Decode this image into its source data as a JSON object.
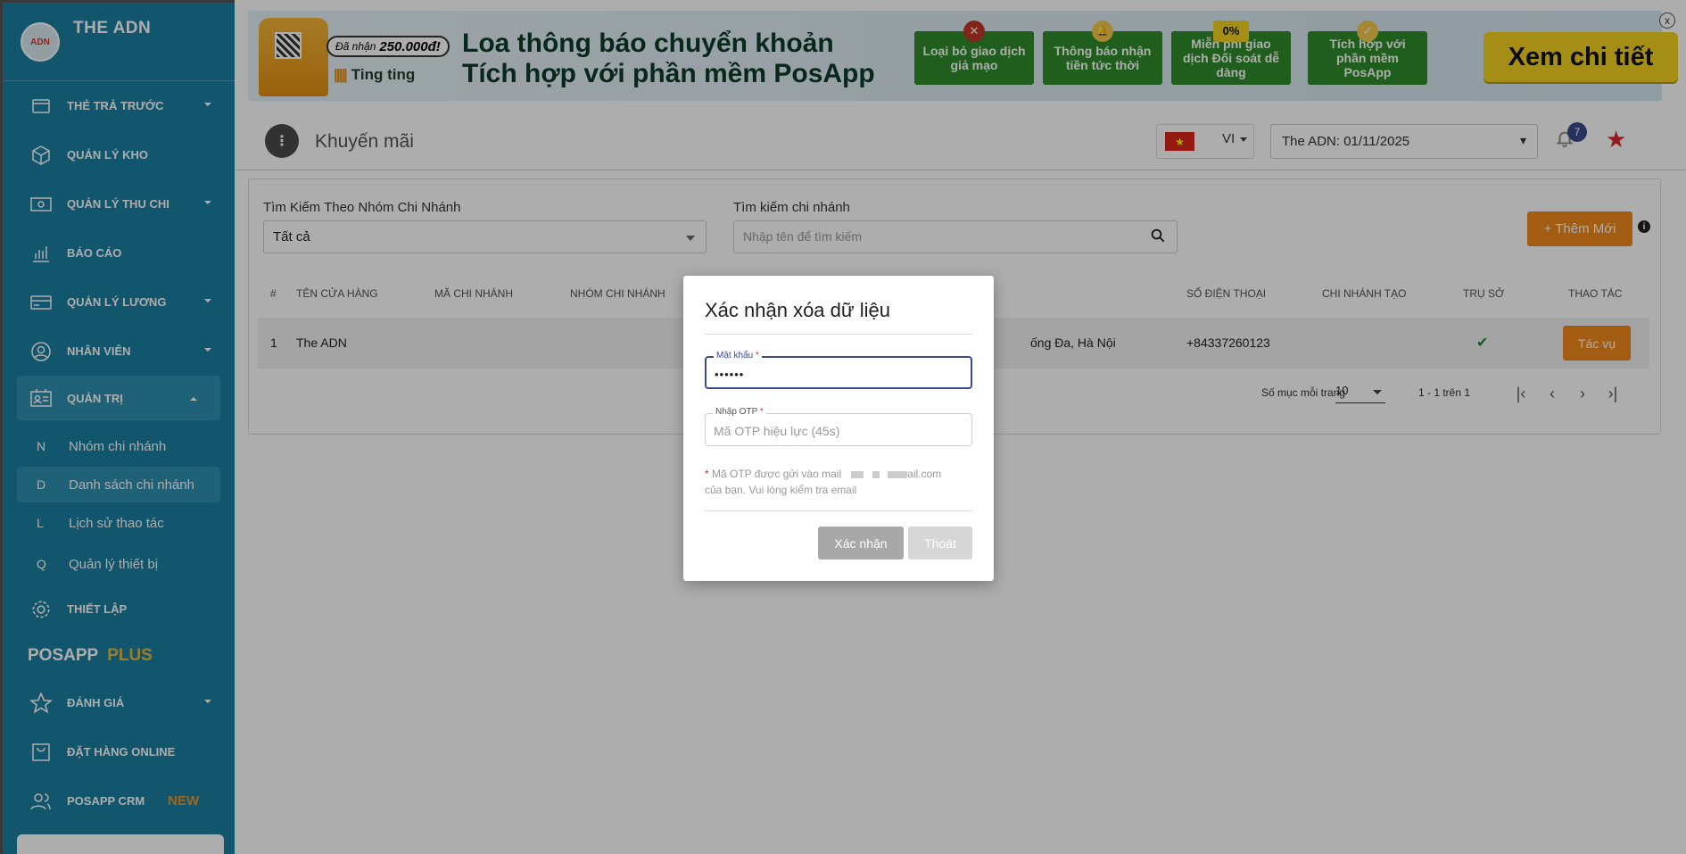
{
  "sidebar": {
    "brand": "THE ADN",
    "logo_text": "ADN",
    "nav": {
      "prepaid": "THẺ TRẢ TRƯỚC",
      "warehouse": "QUẢN LÝ KHO",
      "finance": "QUẢN LÝ THU CHI",
      "report": "BÁO CÁO",
      "salary": "QUẢN LÝ LƯƠNG",
      "staff": "NHÂN VIÊN",
      "admin": "QUẢN TRỊ",
      "settings": "THIẾT LẬP",
      "review": "ĐÁNH GIÁ",
      "online_order": "ĐẶT HÀNG ONLINE",
      "crm": "POSAPP CRM",
      "crm_badge": "NEW"
    },
    "sub_items": [
      {
        "letter": "N",
        "label": "Nhóm chi nhánh"
      },
      {
        "letter": "D",
        "label": "Danh sách chi nhánh"
      },
      {
        "letter": "L",
        "label": "Lịch sử thao tác"
      },
      {
        "letter": "Q",
        "label": "Quản lý thiết bị"
      }
    ],
    "section_title": "POSAPP",
    "section_plus": "PLUS"
  },
  "banner": {
    "pill_prefix": "Đã nhận",
    "pill_amount": "250.000đ!",
    "ting": "Ting ting",
    "headline_1": "Loa thông báo chuyển khoản",
    "headline_2": "Tích hợp với phần mềm PosApp",
    "features": [
      {
        "label": "Loại bỏ giao dịch giả mạo",
        "badge": "✕"
      },
      {
        "label": "Thông báo nhận tiền tức thời",
        "badge": "🔔"
      },
      {
        "label": "Miễn phí giao dịch Đối soát dễ dàng",
        "badge": "0%"
      },
      {
        "label": "Tích hợp với phần mềm PosApp",
        "badge": "✓"
      }
    ],
    "cta": "Xem chi tiết",
    "close": "x"
  },
  "topbar": {
    "menu_icon": "⋮",
    "title": "Khuyến mãi",
    "flag": "★",
    "lang": "VI",
    "branch": "The ADN: 01/11/2025",
    "notif_count": "7"
  },
  "filters": {
    "group_label": "Tìm Kiếm Theo Nhóm Chi Nhánh",
    "group_value": "Tất cả",
    "branch_label": "Tìm kiếm chi nhánh",
    "branch_placeholder": "Nhập tên để tìm kiếm",
    "add_button": "+ Thêm Mới",
    "info": "i"
  },
  "table": {
    "headers": {
      "index": "#",
      "store": "TÊN CỬA HÀNG",
      "code": "MÃ CHI NHÁNH",
      "group": "NHÓM CHI NHÁNH",
      "phone": "SỐ ĐIỆN THOẠI",
      "creator": "CHI NHÁNH TẠO",
      "hq": "TRỤ SỞ",
      "action": "THAO TÁC"
    },
    "row": {
      "index": "1",
      "store": "The ADN",
      "address_tail": "ống Đa, Hà Nội",
      "phone": "+84337260123",
      "action": "Tác vụ"
    },
    "pagination": {
      "per_page_label": "Số mục mỗi trang",
      "per_page_value": "10",
      "range": "1 - 1 trên 1"
    }
  },
  "modal": {
    "title": "Xác nhận xóa dữ liệu",
    "password_label": "Mật khẩu",
    "password_value": "••••••",
    "otp_label": "Nhập OTP",
    "otp_placeholder": "Mã OTP hiệu lực (45s)",
    "required_mark": "*",
    "note_prefix": "Mã OTP được gửi vào mail",
    "note_domain": "ail.com",
    "note_suffix": "của bạn. Vui lòng kiểm tra email",
    "confirm": "Xác nhận",
    "exit": "Thoát"
  },
  "colors": {
    "sidebar": "#1a7fa0",
    "accent_orange": "#ef8a1b",
    "focus_blue": "#3b4b8c",
    "banner_green": "#2f8b2a",
    "cta_yellow": "#f2d21f"
  }
}
